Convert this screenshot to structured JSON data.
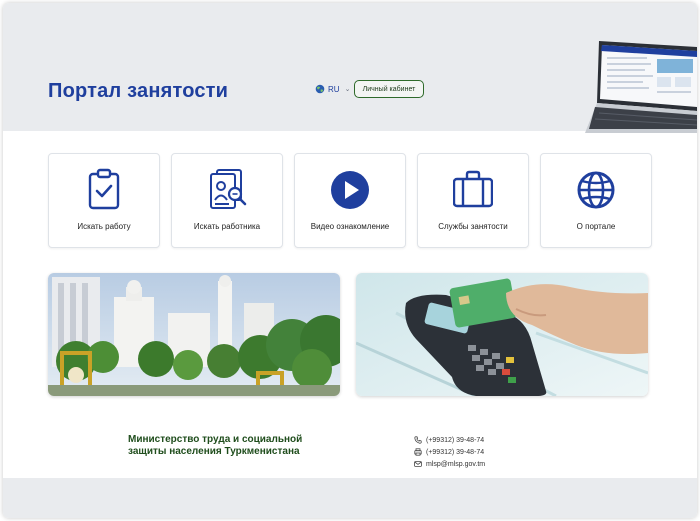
{
  "header": {
    "title": "Портал занятости",
    "language": "RU",
    "cabinet_button": "Личный кабинет"
  },
  "cards": [
    {
      "label": "Искать работу",
      "icon": "clipboard-check-icon"
    },
    {
      "label": "Искать работника",
      "icon": "resume-search-icon"
    },
    {
      "label": "Видео ознакомление",
      "icon": "play-circle-icon"
    },
    {
      "label": "Службы занятости",
      "icon": "briefcase-icon"
    },
    {
      "label": "О портале",
      "icon": "globe-icon"
    }
  ],
  "footer": {
    "ministry_line1": "Министерство труда и социальной",
    "ministry_line2": "защиты населения Туркменистана",
    "phone": "(+99312) 39-48-74",
    "fax": "(+99312) 39-48-74",
    "email": "mlsp@mlsp.gov.tm"
  },
  "colors": {
    "brand_blue": "#1f3f9e",
    "ministry_green": "#1f4d1c",
    "header_bg": "#e9ebee"
  }
}
